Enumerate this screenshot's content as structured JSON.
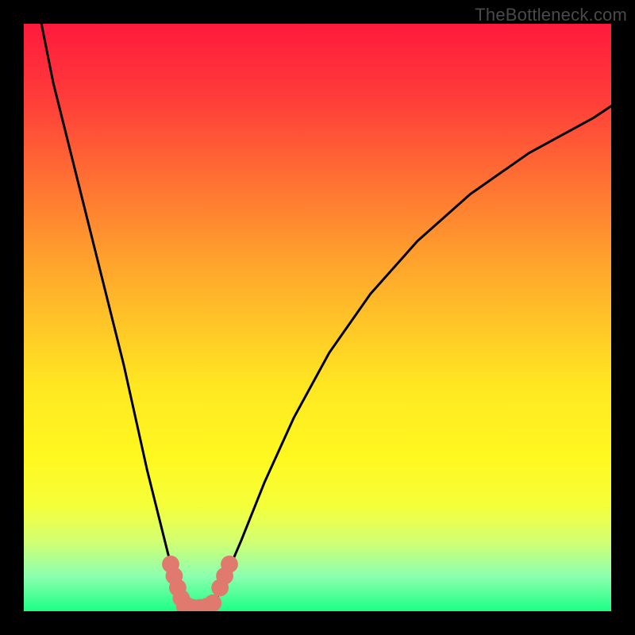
{
  "watermark": "TheBottleneck.com",
  "chart_data": {
    "type": "line",
    "title": "",
    "xlabel": "",
    "ylabel": "",
    "xlim": [
      0,
      100
    ],
    "ylim": [
      0,
      100
    ],
    "grid": false,
    "legend": false,
    "gradient_bands": [
      {
        "y": 0,
        "color": "#1cff84"
      },
      {
        "y": 6,
        "color": "#8cffb0"
      },
      {
        "y": 12,
        "color": "#d4ff70"
      },
      {
        "y": 18,
        "color": "#f5ff3a"
      },
      {
        "y": 26,
        "color": "#fff820"
      },
      {
        "y": 38,
        "color": "#ffe822"
      },
      {
        "y": 50,
        "color": "#ffc228"
      },
      {
        "y": 62,
        "color": "#ff9a2e"
      },
      {
        "y": 75,
        "color": "#ff6a34"
      },
      {
        "y": 88,
        "color": "#ff3a3a"
      },
      {
        "y": 100,
        "color": "#ff1a3c"
      }
    ],
    "series": [
      {
        "name": "bottleneck-curve-left",
        "x": [
          3,
          5,
          8,
          11,
          14,
          17,
          19,
          21,
          23,
          24.5,
          25.5,
          26.5,
          27
        ],
        "y": [
          100,
          90,
          78,
          66,
          54,
          42,
          33,
          24,
          16,
          10,
          6,
          3,
          0
        ]
      },
      {
        "name": "bottleneck-curve-flat",
        "x": [
          27,
          28,
          29,
          30,
          31,
          32
        ],
        "y": [
          0,
          0,
          0,
          0,
          0,
          0
        ]
      },
      {
        "name": "bottleneck-curve-right",
        "x": [
          32,
          34,
          37,
          41,
          46,
          52,
          59,
          67,
          76,
          86,
          97,
          100
        ],
        "y": [
          0,
          5,
          12,
          22,
          33,
          44,
          54,
          63,
          71,
          78,
          84,
          86
        ]
      }
    ],
    "markers": [
      {
        "name": "dot",
        "x": 25.0,
        "y": 8.0,
        "r": 1.0,
        "color": "#e07a6e"
      },
      {
        "name": "dot",
        "x": 25.6,
        "y": 6.0,
        "r": 1.0,
        "color": "#e07a6e"
      },
      {
        "name": "dot",
        "x": 26.2,
        "y": 4.0,
        "r": 1.0,
        "color": "#e07a6e"
      },
      {
        "name": "dot",
        "x": 26.8,
        "y": 2.2,
        "r": 1.0,
        "color": "#e07a6e"
      },
      {
        "name": "dot",
        "x": 27.6,
        "y": 0.8,
        "r": 1.2,
        "color": "#e07a6e"
      },
      {
        "name": "dot",
        "x": 28.8,
        "y": 0.4,
        "r": 1.2,
        "color": "#e07a6e"
      },
      {
        "name": "dot",
        "x": 30.0,
        "y": 0.4,
        "r": 1.2,
        "color": "#e07a6e"
      },
      {
        "name": "dot",
        "x": 31.2,
        "y": 0.6,
        "r": 1.2,
        "color": "#e07a6e"
      },
      {
        "name": "dot",
        "x": 32.2,
        "y": 1.4,
        "r": 1.0,
        "color": "#e07a6e"
      },
      {
        "name": "dot",
        "x": 33.4,
        "y": 4.0,
        "r": 1.0,
        "color": "#e07a6e"
      },
      {
        "name": "dot",
        "x": 34.2,
        "y": 6.0,
        "r": 1.0,
        "color": "#e07a6e"
      },
      {
        "name": "dot",
        "x": 35.0,
        "y": 8.0,
        "r": 1.0,
        "color": "#e07a6e"
      }
    ]
  }
}
